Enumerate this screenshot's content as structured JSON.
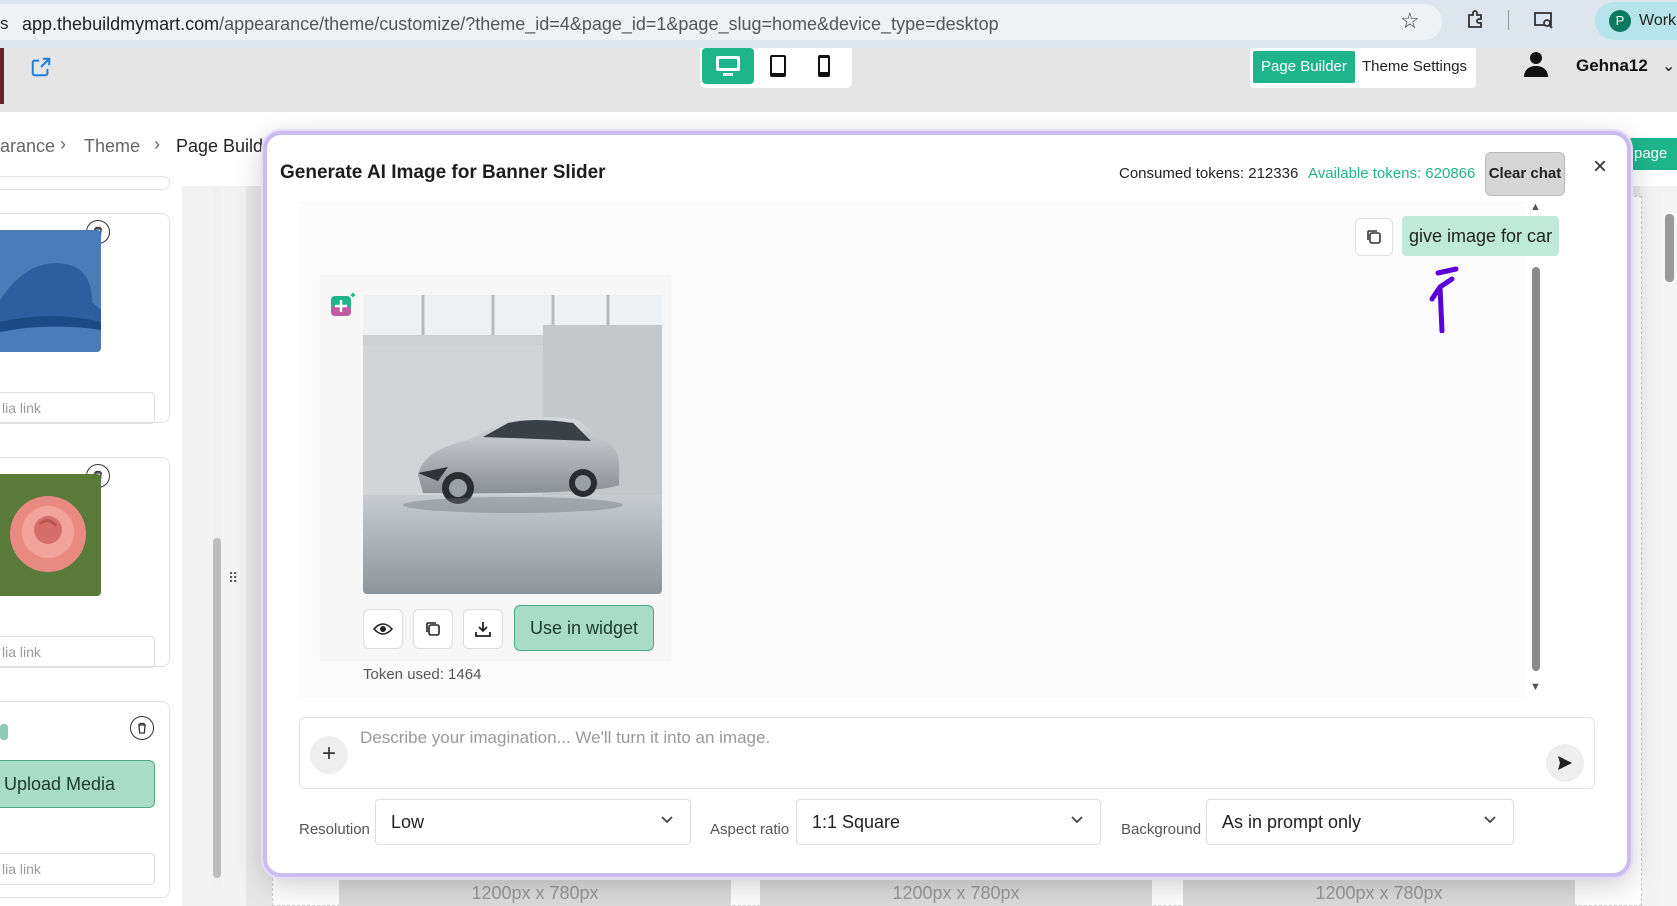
{
  "browser": {
    "url_host": "app.thebuildmymart.com",
    "url_path": "/appearance/theme/customize/?theme_id=4&page_id=1&page_slug=home&device_type=desktop",
    "url_edge": "s",
    "profile_initial": "P",
    "profile_label": "Work"
  },
  "header": {
    "mode_tabs": [
      "Page Builder",
      "Theme Settings"
    ],
    "active_mode": "Page Builder",
    "user_name": "Gehna12",
    "devices": [
      "desktop",
      "tablet",
      "mobile"
    ],
    "active_device": "desktop"
  },
  "breadcrumb": [
    "arance",
    "Theme",
    "Page Builde"
  ],
  "save_page_label": "page",
  "sidebar": {
    "media_link_placeholder": "lia link",
    "upload_label": "Upload Media"
  },
  "canvas": {
    "size_labels": [
      "1200px x 780px",
      "1200px x 780px",
      "1200px x 780px"
    ]
  },
  "modal": {
    "title": "Generate AI Image for Banner Slider",
    "consumed_tokens": "Consumed tokens: 212336",
    "available_tokens": "Available tokens: 620866",
    "clear_chat": "Clear chat",
    "close_icon": "×",
    "user_message": "give image for car",
    "use_in_widget": "Use in widget",
    "token_used": "Token used: 1464",
    "prompt_placeholder": "Describe your imagination... We'll turn it into an image.",
    "options": {
      "resolution_label": "Resolution",
      "resolution_value": "Low",
      "aspect_label": "Aspect ratio",
      "aspect_value": "1:1 Square",
      "background_label": "Background",
      "background_value": "As in prompt only"
    }
  },
  "colors": {
    "accent": "#1fb58a",
    "modal_border": "#cbbcf0",
    "annotation": "#5b00d6"
  }
}
